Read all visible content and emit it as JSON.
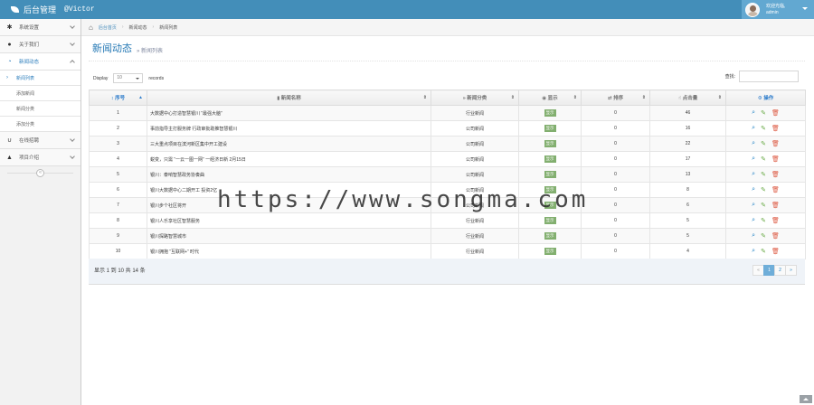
{
  "brand": {
    "title": "后台管理",
    "subtitle": "@Victor"
  },
  "user": {
    "greeting": "欢迎光临,",
    "name": "admin"
  },
  "sidebar": {
    "items": [
      {
        "label": "系统设置",
        "icon": "gear-icon"
      },
      {
        "label": "关于我们",
        "icon": "user-icon"
      },
      {
        "label": "新闻动态",
        "icon": "rss-icon"
      },
      {
        "label": "在线招聘",
        "icon": "magnet-icon"
      },
      {
        "label": "项目介绍",
        "icon": "upload-icon"
      }
    ],
    "news_sub": [
      "新闻列表",
      "添加新闻",
      "新闻分类",
      "添加分类"
    ]
  },
  "breadcrumb": {
    "home": "后台首页",
    "section": "新闻动态",
    "page": "新闻列表"
  },
  "header": {
    "title": "新闻动态",
    "subtitle": "» 新闻列表"
  },
  "controls": {
    "display_label": "Display",
    "page_length": "10",
    "records_label": "records",
    "search_label": "查找:"
  },
  "table": {
    "columns": [
      "序号",
      "新闻名称",
      "新闻分类",
      "显示",
      "排序",
      "点击量",
      "操作"
    ],
    "rows": [
      {
        "id": "1",
        "title": "大数据中心打造智慧银川 “最强大脑”",
        "category": "行业新闻",
        "show": "显示",
        "sort": "0",
        "clicks": "46"
      },
      {
        "id": "2",
        "title": "事前指导主打服务牌 行政审批助推智慧银川",
        "category": "公司新闻",
        "show": "显示",
        "sort": "0",
        "clicks": "16"
      },
      {
        "id": "3",
        "title": "三大重点项目在滨河新区集中开工建设",
        "category": "公司新闻",
        "show": "显示",
        "sort": "0",
        "clicks": "22"
      },
      {
        "id": "4",
        "title": "蜕变，只需 “一云一图一网” 一经济日新 2月15日",
        "category": "公司新闻",
        "show": "显示",
        "sort": "0",
        "clicks": "17"
      },
      {
        "id": "5",
        "title": "银川：泰响智慧政务协奏曲",
        "category": "公司新闻",
        "show": "显示",
        "sort": "0",
        "clicks": "13"
      },
      {
        "id": "6",
        "title": "银川大数据中心二期开工 投资2亿",
        "category": "公司新闻",
        "show": "显示",
        "sort": "0",
        "clicks": "8"
      },
      {
        "id": "7",
        "title": "银川步个社区将开",
        "category": "公司新闻",
        "show": "显示",
        "sort": "0",
        "clicks": "6"
      },
      {
        "id": "8",
        "title": "银川人乐享社区智慧服务",
        "category": "行业新闻",
        "show": "显示",
        "sort": "0",
        "clicks": "5"
      },
      {
        "id": "9",
        "title": "银川探路智慧城市",
        "category": "行业新闻",
        "show": "显示",
        "sort": "0",
        "clicks": "5"
      },
      {
        "id": "10",
        "title": "银川拥抱 “互联网+” 时代",
        "category": "行业新闻",
        "show": "显示",
        "sort": "0",
        "clicks": "4"
      }
    ]
  },
  "footer": {
    "info": "显示 1 到 10 共 14 条",
    "pages": [
      "«",
      "1",
      "2",
      "»"
    ]
  },
  "watermark": "https://www.songma.com",
  "colors": {
    "navbar": "#438eb9",
    "accent": "#2679b5",
    "badge": "#82af6f",
    "view": "#2283c5",
    "edit": "#69aa46",
    "delete": "#dd5a43"
  }
}
